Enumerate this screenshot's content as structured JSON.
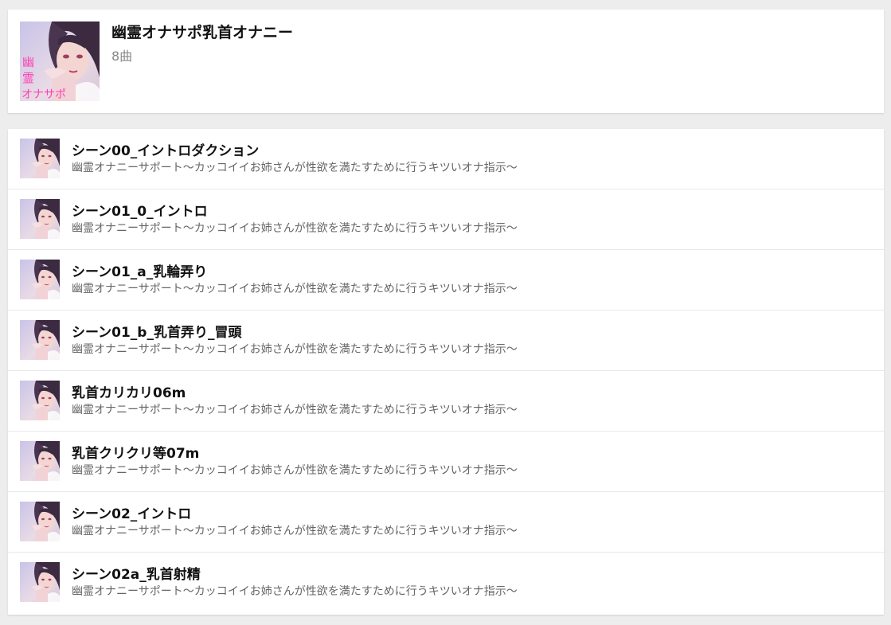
{
  "album": {
    "title": "幽霊オナサポ乳首オナニー",
    "count": "8曲",
    "art_text": [
      "幽",
      "霊",
      "オナサポ"
    ]
  },
  "tracks": [
    {
      "title": "シーン00_イントロダクション",
      "subtitle": "幽霊オナニーサポート〜カッコイイお姉さんが性欲を満たすために行うキツいオナ指示〜"
    },
    {
      "title": "シーン01_0_イントロ",
      "subtitle": "幽霊オナニーサポート〜カッコイイお姉さんが性欲を満たすために行うキツいオナ指示〜"
    },
    {
      "title": "シーン01_a_乳輪弄り",
      "subtitle": "幽霊オナニーサポート〜カッコイイお姉さんが性欲を満たすために行うキツいオナ指示〜"
    },
    {
      "title": "シーン01_b_乳首弄り_冒頭",
      "subtitle": "幽霊オナニーサポート〜カッコイイお姉さんが性欲を満たすために行うキツいオナ指示〜"
    },
    {
      "title": "乳首カリカリ06m",
      "subtitle": "幽霊オナニーサポート〜カッコイイお姉さんが性欲を満たすために行うキツいオナ指示〜"
    },
    {
      "title": "乳首クリクリ等07m",
      "subtitle": "幽霊オナニーサポート〜カッコイイお姉さんが性欲を満たすために行うキツいオナ指示〜"
    },
    {
      "title": "シーン02_イントロ",
      "subtitle": "幽霊オナニーサポート〜カッコイイお姉さんが性欲を満たすために行うキツいオナ指示〜"
    },
    {
      "title": "シーン02a_乳首射精",
      "subtitle": "幽霊オナニーサポート〜カッコイイお姉さんが性欲を満たすために行うキツいオナ指示〜"
    }
  ],
  "colors": {
    "background": "#ededed",
    "card": "#ffffff",
    "art_pink": "#ff3fb0",
    "art_hair": "#3b2a40",
    "art_skin": "#f3d6d2"
  }
}
